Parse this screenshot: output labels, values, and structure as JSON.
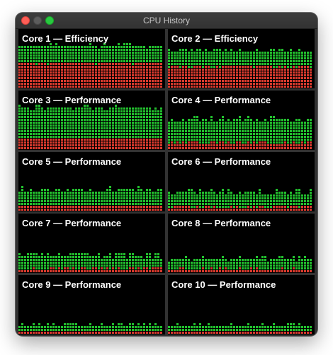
{
  "window": {
    "title": "CPU History",
    "controls": [
      "close",
      "minimize",
      "zoom"
    ]
  },
  "colors": {
    "user": "#22c02e",
    "system": "#d83a2e",
    "background": "#000000"
  },
  "cores": [
    {
      "label": "Core 1 — Efficiency",
      "user_load": 0.32,
      "system_load": 0.44,
      "variance": 0.04
    },
    {
      "label": "Core 2 — Efficiency",
      "user_load": 0.3,
      "system_load": 0.38,
      "variance": 0.04
    },
    {
      "label": "Core 3 — Performance",
      "user_load": 0.55,
      "system_load": 0.2,
      "variance": 0.04
    },
    {
      "label": "Core 4 — Performance",
      "user_load": 0.42,
      "system_load": 0.12,
      "variance": 0.05
    },
    {
      "label": "Core 5 — Performance",
      "user_load": 0.28,
      "system_load": 0.1,
      "variance": 0.05
    },
    {
      "label": "Core 6 — Performance",
      "user_load": 0.27,
      "system_load": 0.08,
      "variance": 0.05
    },
    {
      "label": "Core 7 — Performance",
      "user_load": 0.24,
      "system_load": 0.07,
      "variance": 0.05
    },
    {
      "label": "Core 8 — Performance",
      "user_load": 0.2,
      "system_load": 0.06,
      "variance": 0.05
    },
    {
      "label": "Core 9 — Performance",
      "user_load": 0.12,
      "system_load": 0.05,
      "variance": 0.04
    },
    {
      "label": "Core 10 — Performance",
      "user_load": 0.11,
      "system_load": 0.05,
      "variance": 0.03
    }
  ]
}
